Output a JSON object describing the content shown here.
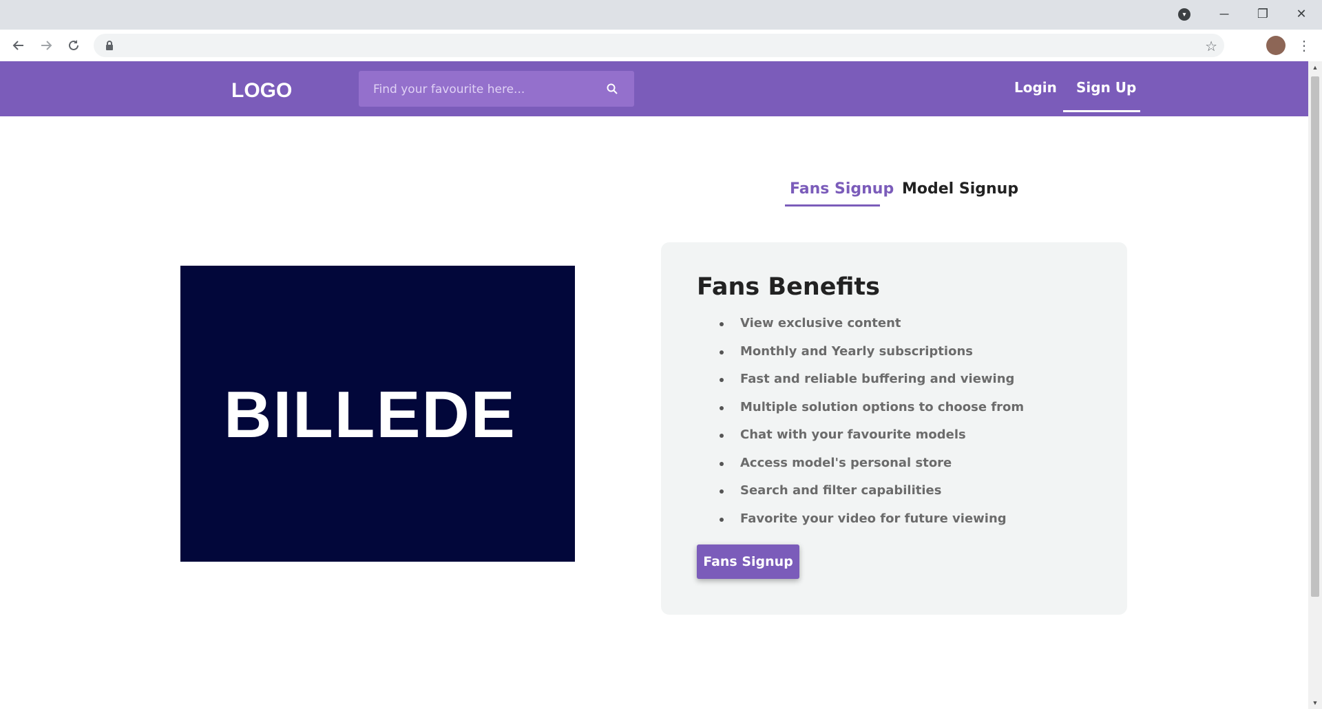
{
  "browser": {
    "window_controls": {
      "minimize": "─",
      "restore": "❐",
      "close": "✕"
    },
    "omnibox_url": "",
    "icons": [
      "back-arrow-icon",
      "forward-arrow-icon",
      "reload-icon",
      "lock-icon",
      "bookmark-star-icon",
      "profile-avatar",
      "more-menu-icon"
    ]
  },
  "header": {
    "logo": "LOGO",
    "search": {
      "placeholder": "Find your favourite here...",
      "value": ""
    },
    "nav": {
      "login": "Login",
      "signup": "Sign Up"
    }
  },
  "tabs": [
    {
      "label": "Fans Signup",
      "active": true
    },
    {
      "label": "Model Signup",
      "active": false
    }
  ],
  "image": {
    "label": "BILLEDE"
  },
  "card": {
    "title": "Fans Benefits",
    "benefits": [
      "View exclusive content",
      "Monthly and Yearly subscriptions",
      "Fast and reliable buffering and viewing",
      "Multiple solution options to choose from",
      "Chat with your favourite models",
      "Access model's personal store",
      "Search and filter capabilities",
      "Favorite your video for future viewing"
    ],
    "button": "Fans Signup"
  },
  "colors": {
    "brand": "#7b5cba",
    "search_bg": "#9470cc",
    "image_bg": "#02073a",
    "card_bg": "#f2f4f4"
  }
}
